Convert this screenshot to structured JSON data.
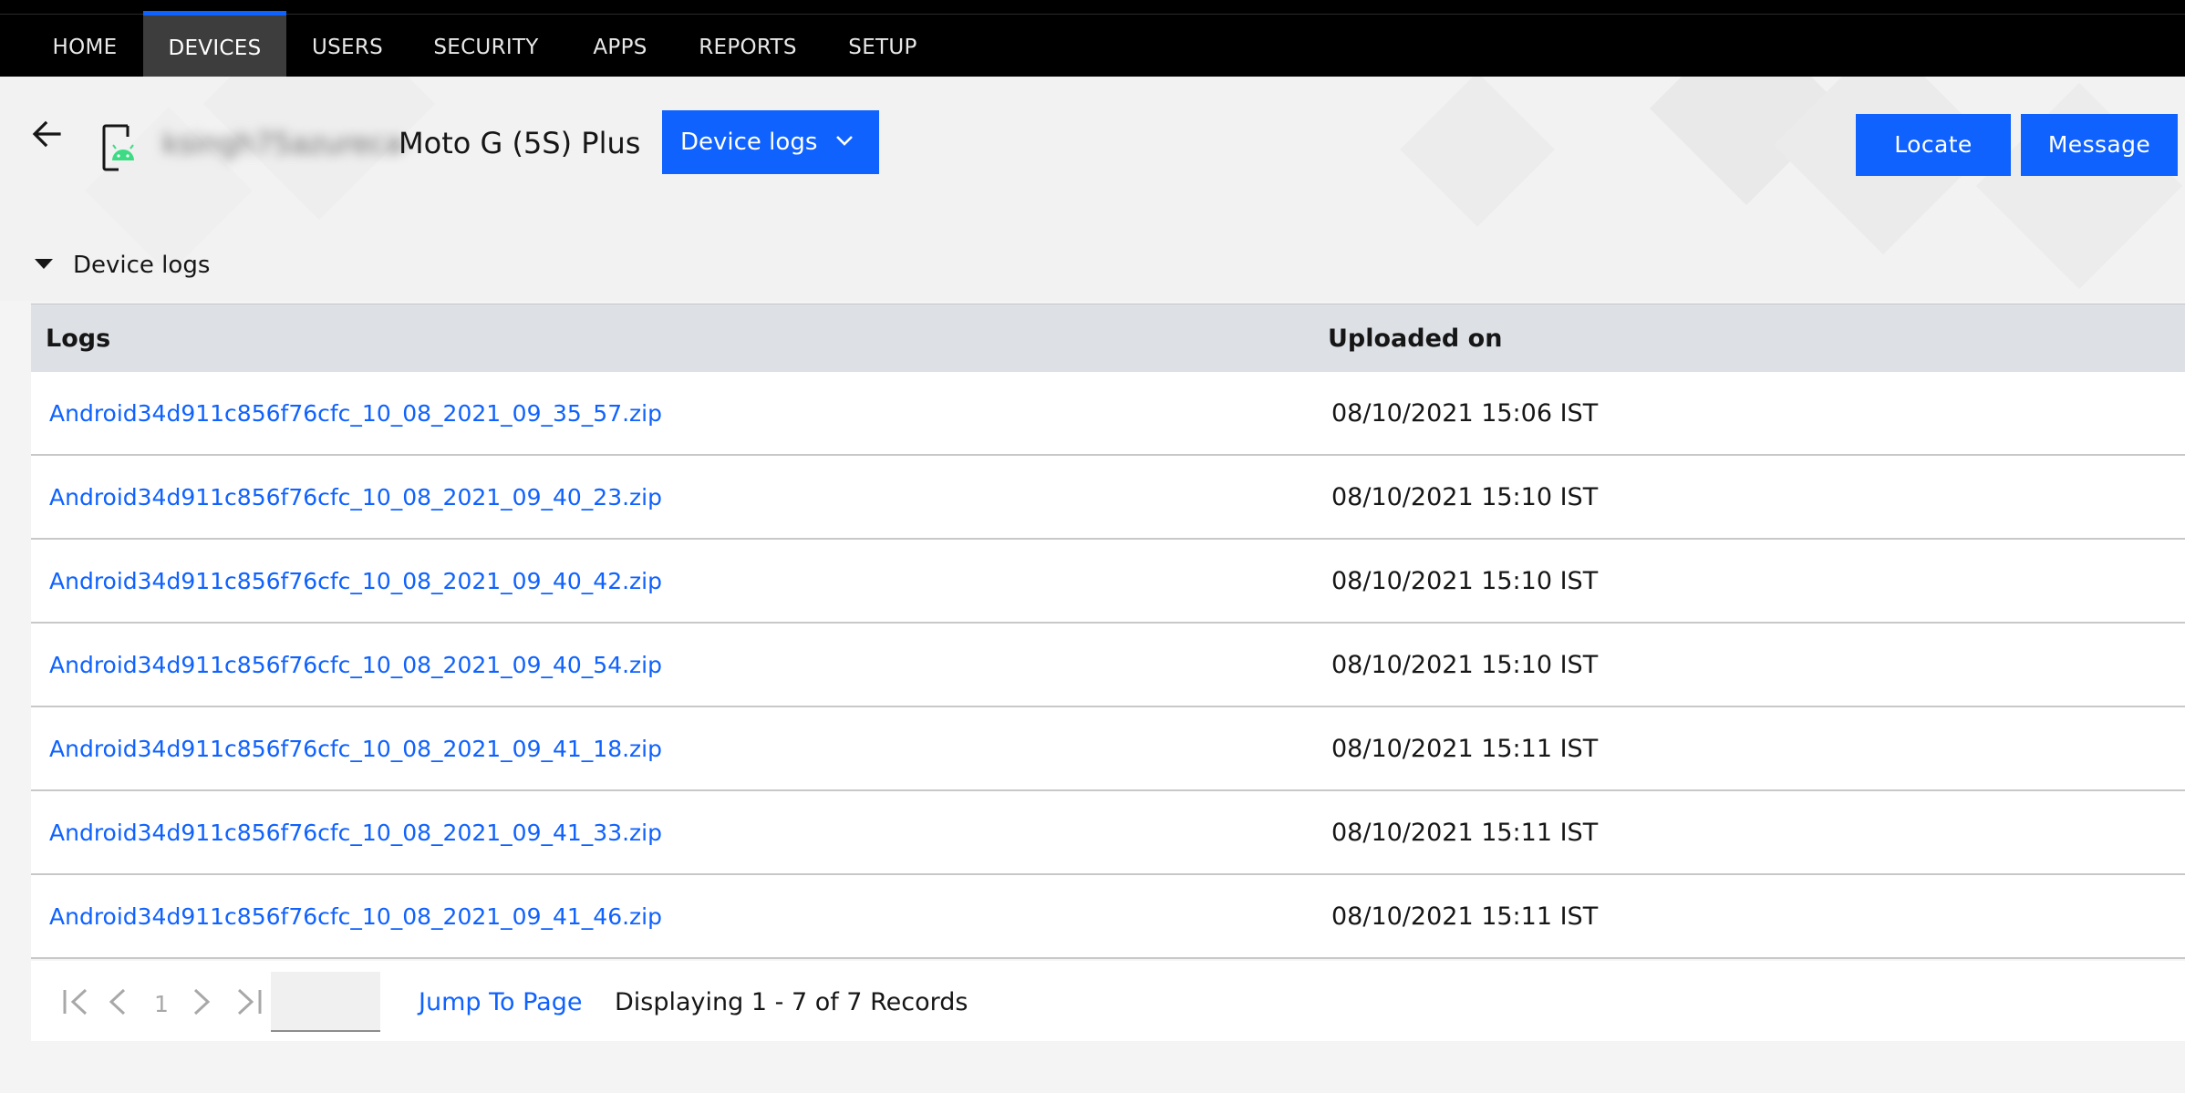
{
  "nav": {
    "items": [
      {
        "label": "HOME"
      },
      {
        "label": "DEVICES",
        "active": true
      },
      {
        "label": "USERS"
      },
      {
        "label": "SECURITY"
      },
      {
        "label": "APPS"
      },
      {
        "label": "REPORTS"
      },
      {
        "label": "SETUP"
      }
    ]
  },
  "header": {
    "back_icon": "arrow-left-icon",
    "device_icon": "android-phone-icon",
    "device_owner": "ksingh75azureca-",
    "device_name": "Moto G (5S) Plus",
    "view_dropdown": {
      "selected": "Device logs",
      "icon": "chevron-down-icon"
    },
    "locate_label": "Locate",
    "message_label": "Message"
  },
  "section": {
    "title": "Device logs",
    "expanded": true
  },
  "table": {
    "columns": [
      "Logs",
      "Uploaded on"
    ],
    "rows": [
      {
        "file": "Android34d911c856f76cfc_10_08_2021_09_35_57.zip",
        "uploaded": "08/10/2021 15:06 IST"
      },
      {
        "file": "Android34d911c856f76cfc_10_08_2021_09_40_23.zip",
        "uploaded": "08/10/2021 15:10 IST"
      },
      {
        "file": "Android34d911c856f76cfc_10_08_2021_09_40_42.zip",
        "uploaded": "08/10/2021 15:10 IST"
      },
      {
        "file": "Android34d911c856f76cfc_10_08_2021_09_40_54.zip",
        "uploaded": "08/10/2021 15:10 IST"
      },
      {
        "file": "Android34d911c856f76cfc_10_08_2021_09_41_18.zip",
        "uploaded": "08/10/2021 15:11 IST"
      },
      {
        "file": "Android34d911c856f76cfc_10_08_2021_09_41_33.zip",
        "uploaded": "08/10/2021 15:11 IST"
      },
      {
        "file": "Android34d911c856f76cfc_10_08_2021_09_41_46.zip",
        "uploaded": "08/10/2021 15:11 IST"
      }
    ]
  },
  "pagination": {
    "current_page": "1",
    "jump_input_value": "",
    "jump_label": "Jump To Page",
    "records_text": "Displaying 1 - 7 of 7 Records"
  },
  "colors": {
    "accent": "#0f62fe",
    "nav_bg": "#000000",
    "nav_active_bg": "#3d3d3d",
    "table_header_bg": "#dde1e6",
    "android_green": "#3ddc84"
  }
}
